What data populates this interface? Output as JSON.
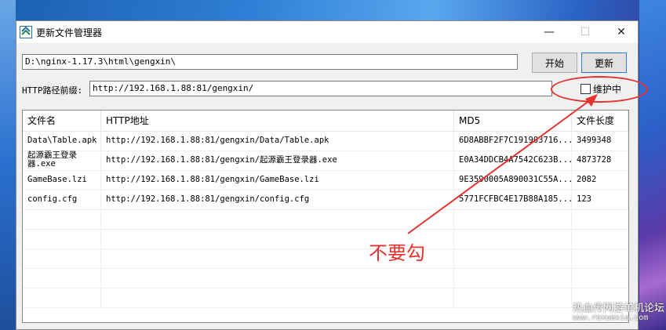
{
  "window": {
    "title": "更新文件管理器",
    "minimize": "—",
    "maximize": "☐",
    "close": "✕"
  },
  "toolbar": {
    "path_value": "D:\\nginx-1.17.3\\html\\gengxin\\",
    "start_label": "开始",
    "update_label": "更新"
  },
  "prefix": {
    "label": "HTTP路径前缀:",
    "value": "http://192.168.1.88:81/gengxin/"
  },
  "maintenance": {
    "label": "维护中",
    "checked": false
  },
  "table": {
    "columns": [
      "文件名",
      "HTTP地址",
      "MD5",
      "文件长度"
    ],
    "rows": [
      {
        "name": "Data\\Table.apk",
        "url": "http://192.168.1.88:81/gengxin/Data/Table.apk",
        "md5": "6D8ABBF2F7C191903716...",
        "size": "3499348"
      },
      {
        "name": "起源霸王登录器.exe",
        "url": "http://192.168.1.88:81/gengxin/起源霸王登录器.exe",
        "md5": "E0A34DDCB4A7542C623B...",
        "size": "4873728"
      },
      {
        "name": "GameBase.lzi",
        "url": "http://192.168.1.88:81/gengxin/GameBase.lzi",
        "md5": "9E3590005A890031C55A...",
        "size": "2082"
      },
      {
        "name": "config.cfg",
        "url": "http://192.168.1.88:81/gengxin/config.cfg",
        "md5": "5771FCFBC4E17B88A185...",
        "size": "123"
      }
    ]
  },
  "annotation": {
    "text": "不要勾",
    "color": "#e8322e"
  },
  "watermark": {
    "text": "热血传网游单机论坛",
    "url": "www.rexuexia.com"
  }
}
